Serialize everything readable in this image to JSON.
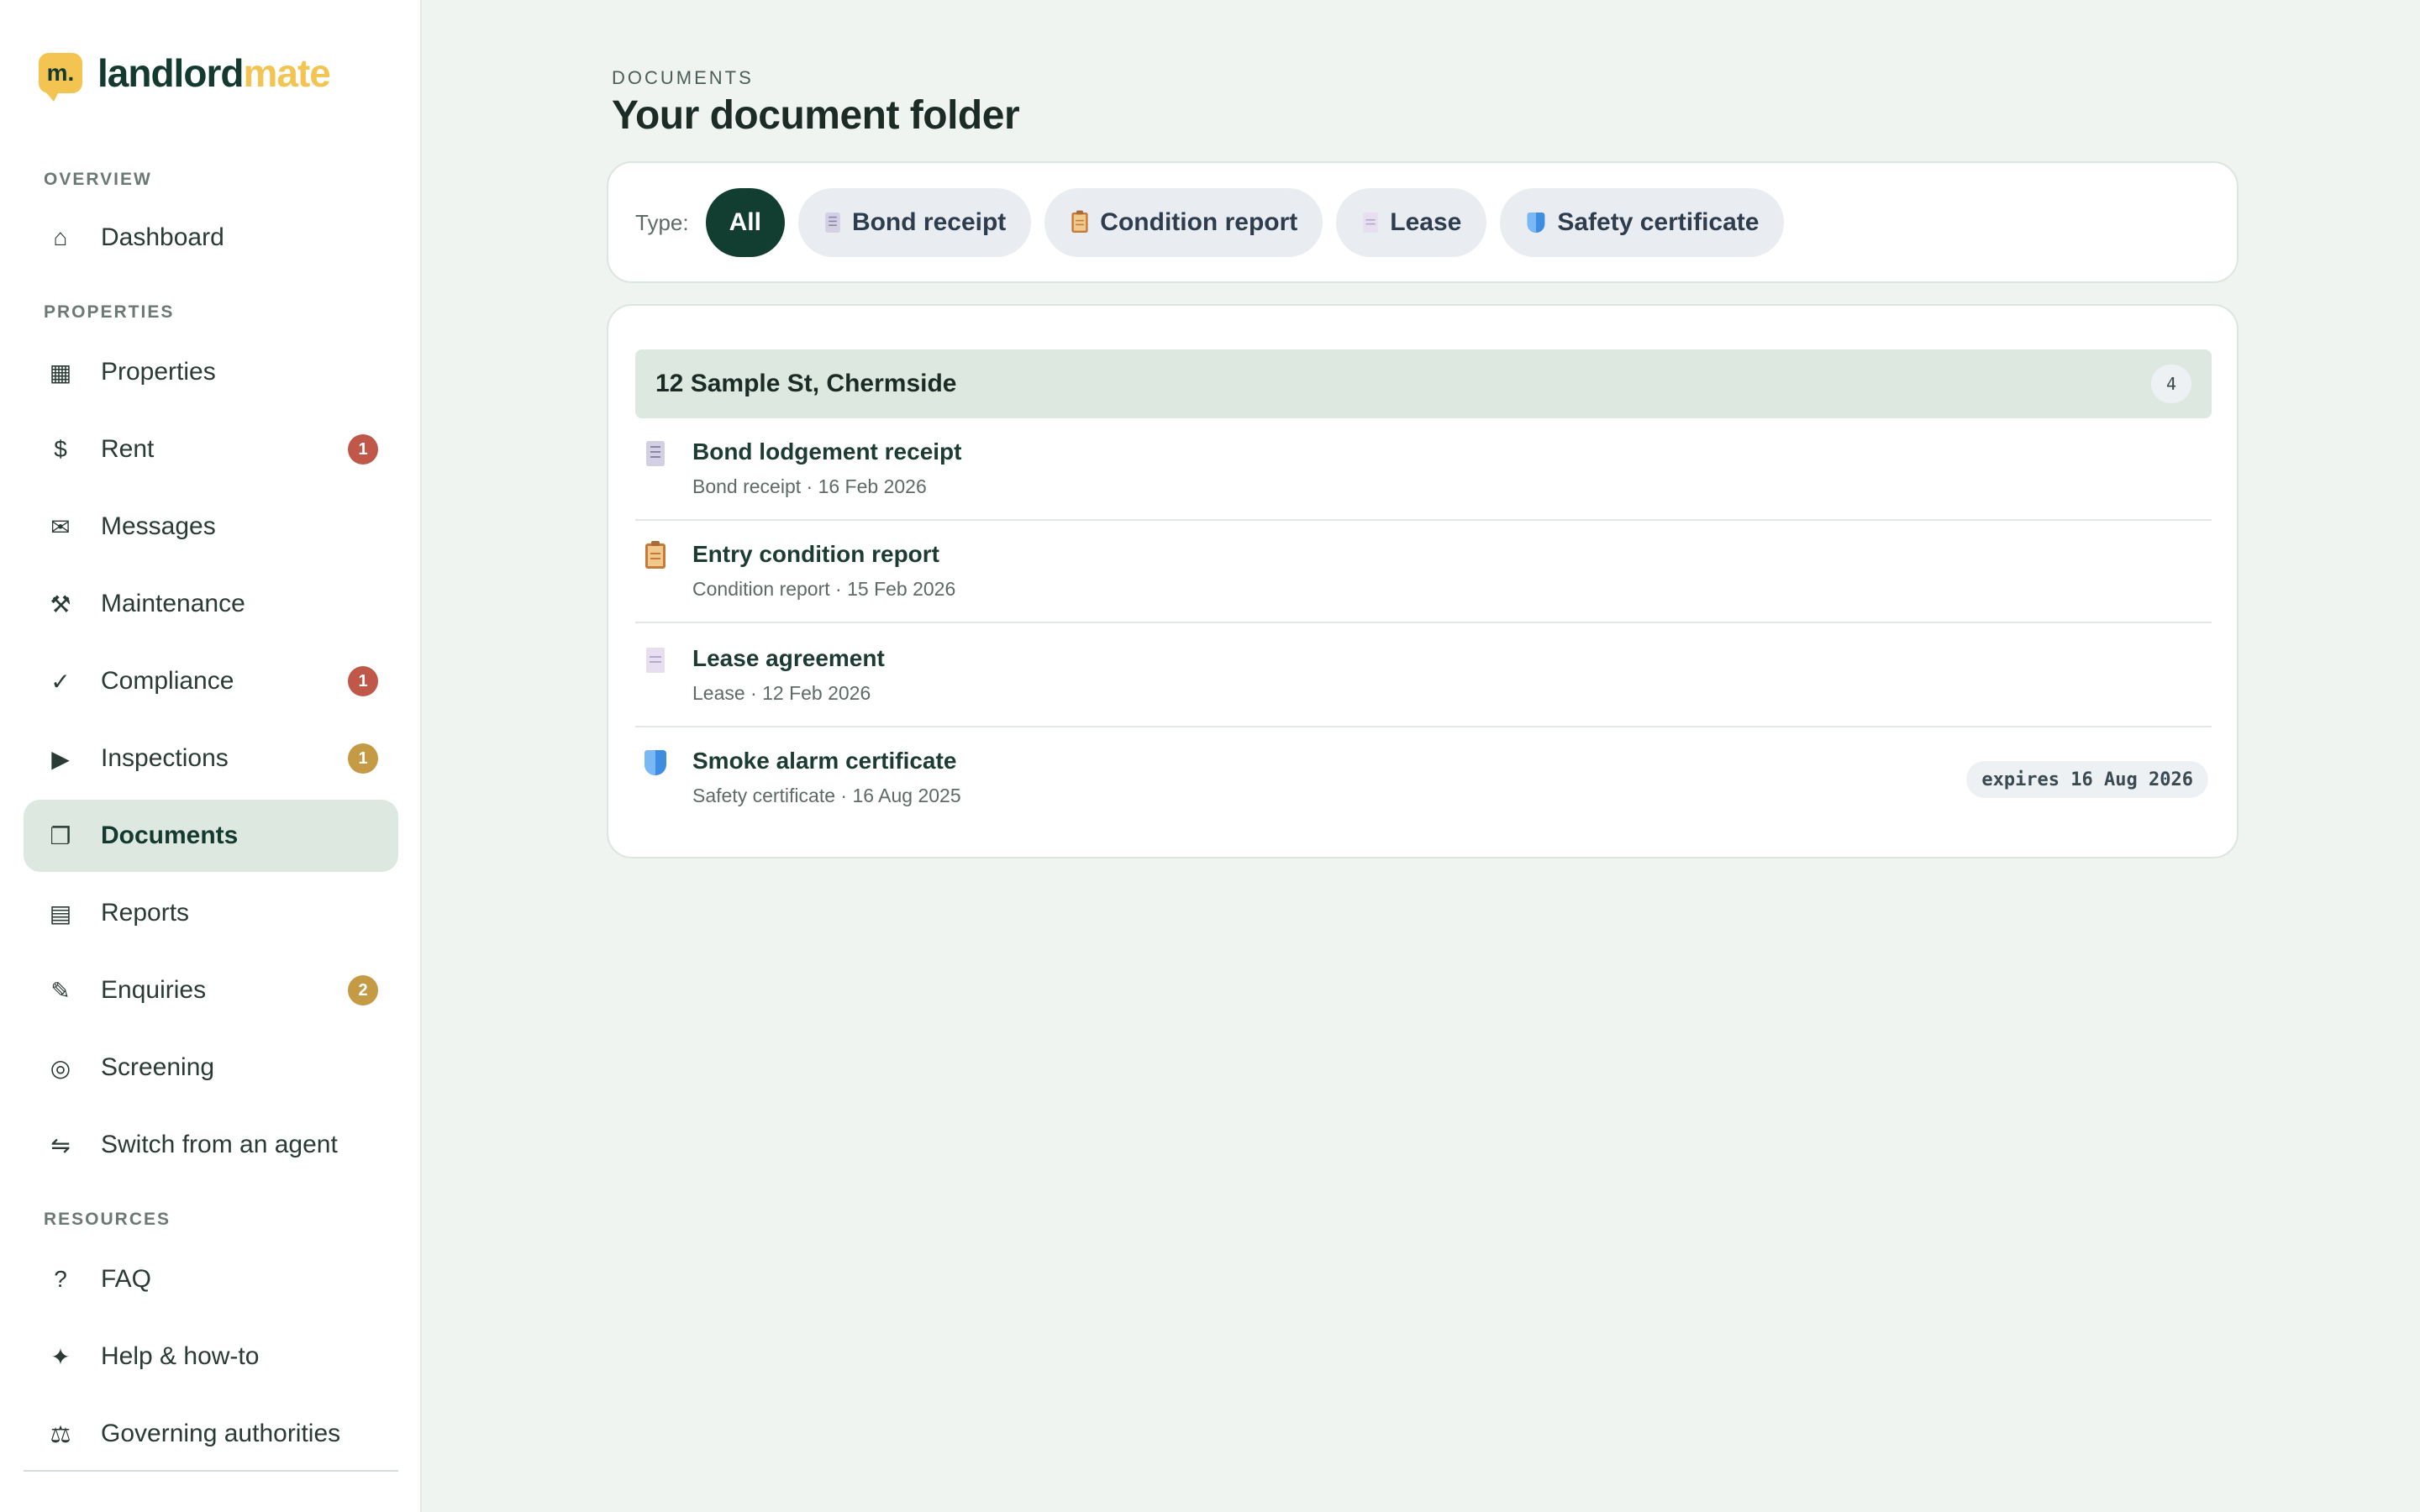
{
  "brand": {
    "mark": "m.",
    "name_a": "landlord",
    "name_b": "mate"
  },
  "sidebar": {
    "sections": {
      "overview": "OVERVIEW",
      "properties": "PROPERTIES",
      "resources": "RESOURCES"
    },
    "items": [
      {
        "label": "Dashboard",
        "icon": "home-icon"
      },
      {
        "label": "Properties",
        "icon": "building-icon"
      },
      {
        "label": "Rent",
        "icon": "dollar-icon",
        "badge": "1"
      },
      {
        "label": "Messages",
        "icon": "mail-icon"
      },
      {
        "label": "Maintenance",
        "icon": "hammer-icon"
      },
      {
        "label": "Compliance",
        "icon": "check-icon",
        "badge": "1"
      },
      {
        "label": "Inspections",
        "icon": "play-icon",
        "badge": "1"
      },
      {
        "label": "Documents",
        "icon": "folder-icon",
        "active": true
      },
      {
        "label": "Reports",
        "icon": "report-icon"
      },
      {
        "label": "Enquiries",
        "icon": "pencil-icon",
        "badge": "2"
      },
      {
        "label": "Screening",
        "icon": "target-icon"
      },
      {
        "label": "Switch from an agent",
        "icon": "swap-icon"
      },
      {
        "label": "FAQ",
        "icon": "question-icon"
      },
      {
        "label": "Help & how-to",
        "icon": "sparkle-icon"
      },
      {
        "label": "Governing authorities",
        "icon": "scales-icon"
      }
    ],
    "badge_colors": {
      "red": "#c0584a",
      "gold": "#c59a45"
    }
  },
  "header": {
    "eyebrow": "DOCUMENTS",
    "title": "Your document folder"
  },
  "filters": {
    "label": "Type:",
    "chips": [
      {
        "label": "All",
        "active": true
      },
      {
        "label": "Bond receipt",
        "icon": "receipt-icon"
      },
      {
        "label": "Condition report",
        "icon": "clipboard-icon"
      },
      {
        "label": "Lease",
        "icon": "page-icon"
      },
      {
        "label": "Safety certificate",
        "icon": "shield-icon"
      }
    ]
  },
  "group": {
    "title": "12 Sample St, Chermside",
    "count": "4",
    "documents": [
      {
        "title": "Bond lodgement receipt",
        "meta": "Bond receipt · 16 Feb 2026",
        "icon": "receipt-icon"
      },
      {
        "title": "Entry condition report",
        "meta": "Condition report · 15 Feb 2026",
        "icon": "clipboard-icon"
      },
      {
        "title": "Lease agreement",
        "meta": "Lease · 12 Feb 2026",
        "icon": "page-icon"
      },
      {
        "title": "Smoke alarm certificate",
        "meta": "Safety certificate · 16 Aug 2025",
        "icon": "shield-icon",
        "expiry": "expires 16 Aug 2026"
      }
    ]
  },
  "colors": {
    "accent_dark": "#123d31",
    "active_bg": "#dce8e0",
    "brand_yellow": "#f4c452",
    "page_bg": "#f0f4f1"
  }
}
